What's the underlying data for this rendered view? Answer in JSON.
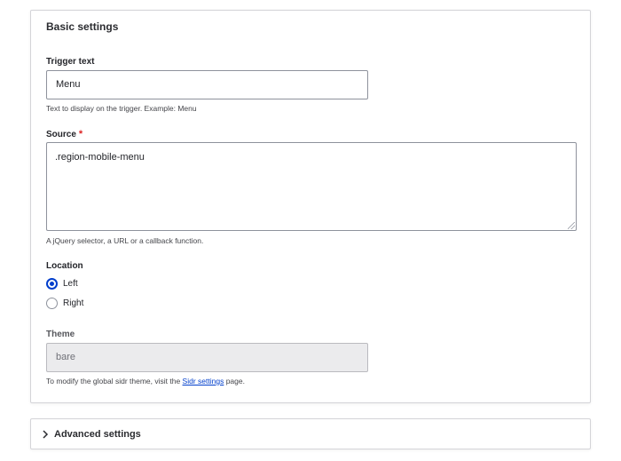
{
  "basic_settings": {
    "title": "Basic settings",
    "trigger_text": {
      "label": "Trigger text",
      "value": "Menu",
      "description": "Text to display on the trigger. Example: Menu"
    },
    "source": {
      "label": "Source",
      "required_mark": "*",
      "value": ".region-mobile-menu",
      "description": "A jQuery selector, a URL or a callback function."
    },
    "location": {
      "label": "Location",
      "options": [
        {
          "label": "Left",
          "checked": true
        },
        {
          "label": "Right",
          "checked": false
        }
      ]
    },
    "theme": {
      "label": "Theme",
      "value": "bare",
      "description_prefix": "To modify the global sidr theme, visit the ",
      "description_link": "Sidr settings",
      "description_suffix": " page."
    }
  },
  "advanced_settings": {
    "title": "Advanced settings",
    "icon": "chevron-right-icon"
  },
  "colors": {
    "accent": "#003ecc",
    "required": "#dc2323",
    "border": "#d4d4d8"
  }
}
